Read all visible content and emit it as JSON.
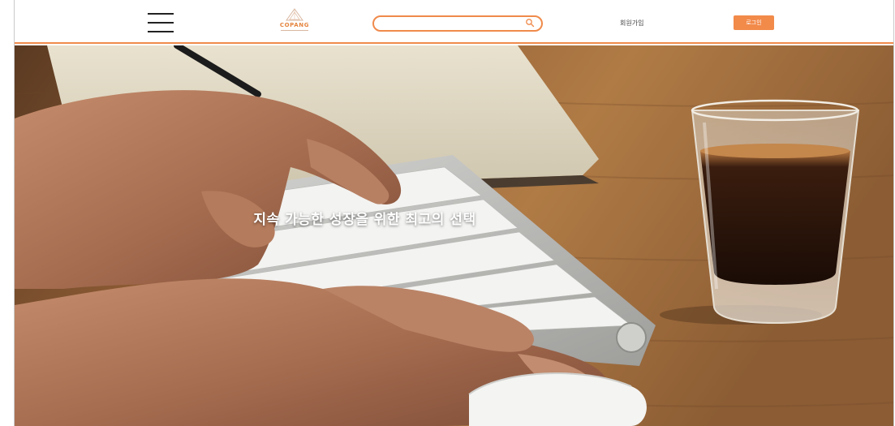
{
  "header": {
    "menu_icon": "hamburger-menu-icon",
    "logo": {
      "text": "COPANG"
    },
    "search": {
      "value": "",
      "placeholder": "",
      "icon": "search-icon"
    },
    "signup_label": "회원가입",
    "login_label": "로그인"
  },
  "hero": {
    "title": "지속 가능한 성장을 위한 최고의 선택"
  },
  "colors": {
    "accent": "#f08a4b",
    "login_button": "#f28a4a",
    "logo_text": "#e5853f"
  }
}
